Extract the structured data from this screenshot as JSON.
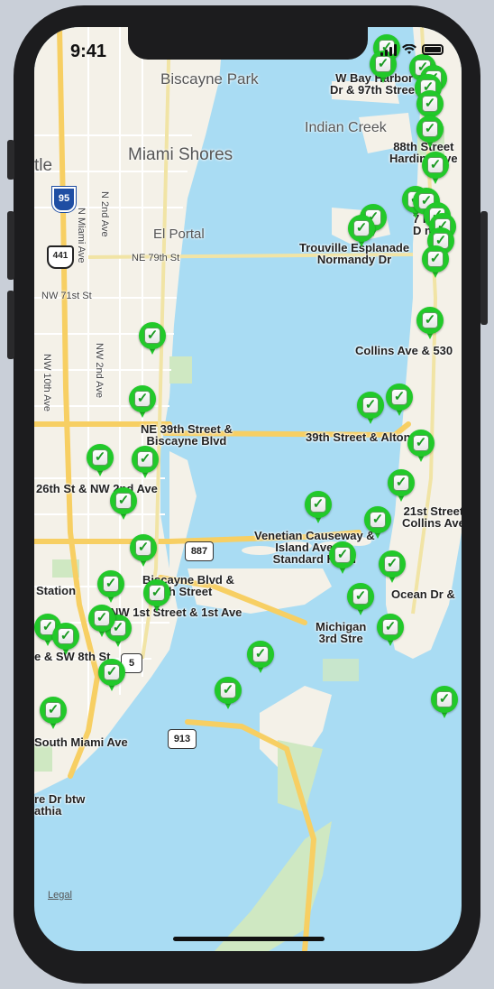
{
  "status_bar": {
    "time": "9:41"
  },
  "map": {
    "places": [
      {
        "id": "biscayne-park",
        "text": "Biscayne\nPark"
      },
      {
        "id": "miami-shores",
        "text": "Miami Shores"
      },
      {
        "id": "el-portal",
        "text": "El Portal"
      },
      {
        "id": "indian-creek",
        "text": "Indian Creek"
      },
      {
        "id": "tle",
        "text": "tle"
      }
    ],
    "streets": [
      {
        "id": "ne-79th",
        "text": "NE 79th St"
      },
      {
        "id": "nw-71st",
        "text": "NW 71st St"
      },
      {
        "id": "n-miami-ave",
        "text": "N Miami Ave"
      },
      {
        "id": "n-2nd-ave",
        "text": "N 2nd Ave"
      },
      {
        "id": "nw-2nd-ave",
        "text": "NW 2nd Ave"
      },
      {
        "id": "nw-10th-ave",
        "text": "NW 10th Ave"
      }
    ],
    "shields": {
      "i95": "95",
      "us441": "441",
      "fl887": "887",
      "fl913": "913",
      "fl5": "5"
    },
    "station_labels": [
      "W Bay Harbor\nDr & 97th Street",
      "88th Street\nHarding Ave",
      "7 Itr\nD ns",
      "Trouville Esplanade\nNormandy Dr",
      "Collins Ave & 530",
      "NE 39th Street &\nBiscayne Blvd",
      "39th Street & Alton Rd",
      "26th St & NW 2nd Ave",
      "21st Street\nCollins Ave",
      "Venetian Causeway &\nIsland Avenue\nStandard Hotel",
      "Biscayne Blvd &\nth Street",
      "Station",
      "NW 1st Street & 1st Ave",
      "Ocean Dr &",
      "Michigan\n3rd Stre",
      "e & SW 8th St",
      "South Miami Ave",
      "re Dr btw\nathia"
    ],
    "legal": "Legal",
    "pin_count": 44
  },
  "colors": {
    "water": "#a9dcf3",
    "land": "#f4f1e8",
    "park": "#cfe8c2",
    "highway": "#f7cf63",
    "pin": "#22c92a"
  }
}
